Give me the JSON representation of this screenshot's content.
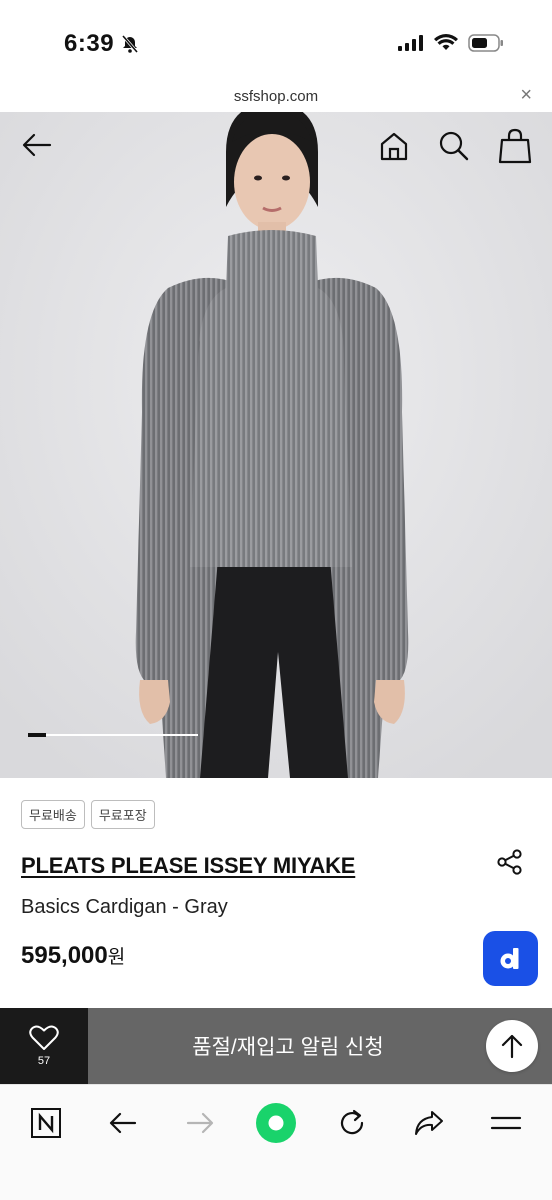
{
  "status_bar": {
    "time": "6:39",
    "icons": [
      "bell-slash-icon",
      "cellular-icon",
      "wifi-icon",
      "battery-icon"
    ]
  },
  "browser": {
    "url": "ssfshop.com",
    "close_glyph": "×"
  },
  "header_icons": [
    "back-arrow-icon",
    "home-icon",
    "search-icon",
    "shopping-bag-icon"
  ],
  "gallery": {
    "current_slide": 1,
    "progress_fraction": 0.1
  },
  "product": {
    "tags": [
      "무료배송",
      "무료포장"
    ],
    "brand": "PLEATS PLEASE ISSEY MIYAKE",
    "name": "Basics Cardigan - Gray",
    "price": "595,000",
    "currency": "원",
    "d_button_label": "d"
  },
  "action_bar": {
    "like_count": "57",
    "restock_label": "품절/재입고 알림 신청"
  },
  "colors": {
    "accent_blue": "#1a50e6",
    "action_bar_gray": "#666666",
    "like_box_black": "#1a1a1a",
    "reload_green": "#19d36b"
  },
  "toolbar_icons": [
    "naver-n-icon",
    "back-icon",
    "forward-icon",
    "green-circle-icon",
    "reload-icon",
    "share-icon",
    "menu-icon"
  ]
}
